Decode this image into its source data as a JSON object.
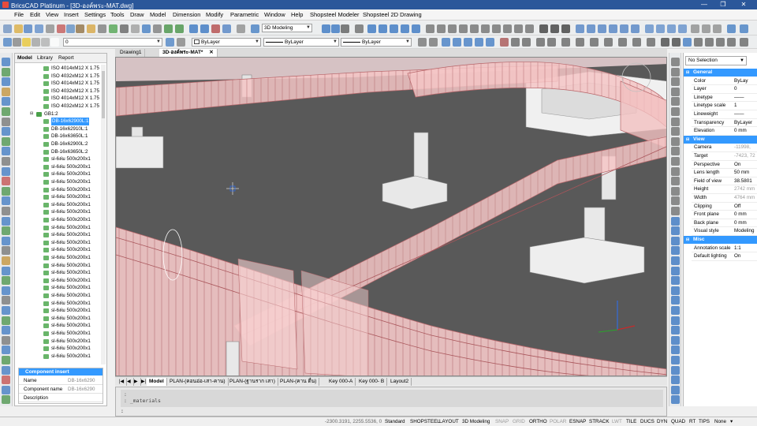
{
  "window": {
    "title": "BricsCAD Platinum - [3D-องค์พระ-MAT.dwg]",
    "controls": [
      "—",
      "❐",
      "✕"
    ]
  },
  "menu": [
    "File",
    "Edit",
    "View",
    "Insert",
    "Settings",
    "Tools",
    "Draw",
    "Model",
    "Dimension",
    "Modify",
    "Parametric",
    "Window",
    "Help",
    "Shopsteel Modeler",
    "Shopsteel 2D Drawing"
  ],
  "toolbar": {
    "layer_value": "0",
    "workspace": "3D Modeling",
    "color": "ByLayer",
    "linetype": "ByLayer",
    "lineweight": "ByLayer"
  },
  "explorer": {
    "tabs": [
      "Model",
      "Library",
      "Report"
    ],
    "tree": [
      {
        "label": "ISO 4014xM12 X 1.75",
        "indent": 4
      },
      {
        "label": "ISO 4032xM12 X 1.75",
        "indent": 4
      },
      {
        "label": "ISO 4014xM12 X 1.75",
        "indent": 4
      },
      {
        "label": "ISO 4032xM12 X 1.75",
        "indent": 4
      },
      {
        "label": "ISO 4014xM12 X 1.75",
        "indent": 4
      },
      {
        "label": "ISO 4032xM12 X 1.75",
        "indent": 4
      },
      {
        "label": "GB1:2",
        "indent": 3
      },
      {
        "label": "DB-16x62900L:1",
        "indent": 4,
        "selected": true
      },
      {
        "label": "DB-16x62910L:1",
        "indent": 4
      },
      {
        "label": "DB-16x63650L:1",
        "indent": 4
      },
      {
        "label": "DB-16x62900L:2",
        "indent": 4
      },
      {
        "label": "DB-16x63650L:2",
        "indent": 4
      },
      {
        "label": "sl-6ล่ม 500x200x1",
        "indent": 4
      },
      {
        "label": "sl-6ล่ม 500x200x1",
        "indent": 4
      },
      {
        "label": "sl-6ล่ม 500x200x1",
        "indent": 4
      },
      {
        "label": "sl-6ล่ม 500x200x1",
        "indent": 4
      },
      {
        "label": "sl-6ล่ม 500x200x1",
        "indent": 4
      },
      {
        "label": "sl-6ล่ม 500x200x1",
        "indent": 4
      },
      {
        "label": "sl-6ล่ม 500x200x1",
        "indent": 4
      },
      {
        "label": "sl-6ล่ม 500x200x1",
        "indent": 4
      },
      {
        "label": "sl-6ล่ม 500x200x1",
        "indent": 4
      },
      {
        "label": "sl-6ล่ม 500x200x1",
        "indent": 4
      },
      {
        "label": "sl-6ล่ม 500x200x1",
        "indent": 4
      },
      {
        "label": "sl-6ล่ม 500x200x1",
        "indent": 4
      },
      {
        "label": "sl-6ล่ม 500x200x1",
        "indent": 4
      },
      {
        "label": "sl-6ล่ม 500x200x1",
        "indent": 4
      },
      {
        "label": "sl-6ล่ม 500x200x1",
        "indent": 4
      },
      {
        "label": "sl-6ล่ม 500x200x1",
        "indent": 4
      },
      {
        "label": "sl-6ล่ม 500x200x1",
        "indent": 4
      },
      {
        "label": "sl-6ล่ม 500x200x1",
        "indent": 4
      },
      {
        "label": "sl-6ล่ม 500x200x1",
        "indent": 4
      },
      {
        "label": "sl-6ล่ม 500x200x1",
        "indent": 4
      },
      {
        "label": "sl-6ล่ม 500x200x1",
        "indent": 4
      },
      {
        "label": "sl-6ล่ม 500x200x1",
        "indent": 4
      },
      {
        "label": "sl-6ล่ม 500x200x1",
        "indent": 4
      },
      {
        "label": "sl-6ล่ม 500x200x1",
        "indent": 4
      },
      {
        "label": "sl-6ล่ม 500x200x1",
        "indent": 4
      },
      {
        "label": "sl-6ล่ม 500x200x1",
        "indent": 4
      },
      {
        "label": "sl-6ล่ม 500x200x1",
        "indent": 4
      }
    ],
    "component_insert": {
      "title": "Component insert",
      "rows": [
        {
          "key": "Name",
          "value": "DB-16x6290"
        },
        {
          "key": "Component name",
          "value": "DB-16x6290"
        },
        {
          "key": "Description",
          "value": ""
        }
      ]
    }
  },
  "doc_tabs": [
    "Drawing1",
    "3D-องค์พระ-MAT*"
  ],
  "layout_tabs": [
    "Model",
    "PLAN-(คอนอ่อ-เสา-คาน)",
    "PLAN-(ฐานราก เสา)",
    "PLAN-(คาน ตื่น)",
    "Key 000-A",
    "Key 000- B",
    "Layout2"
  ],
  "command": {
    "history": [
      ":",
      ": _materials"
    ],
    "prompt": ":"
  },
  "properties": {
    "selection": "No Selection",
    "categories": [
      {
        "name": "General",
        "rows": [
          {
            "key": "Color",
            "value": "ByLay"
          },
          {
            "key": "Layer",
            "value": "0"
          },
          {
            "key": "Linetype",
            "value": "——"
          },
          {
            "key": "Linetype scale",
            "value": "1"
          },
          {
            "key": "Lineweight",
            "value": "——"
          },
          {
            "key": "Transparency",
            "value": "ByLayer"
          },
          {
            "key": "Elevation",
            "value": "0 mm"
          }
        ]
      },
      {
        "name": "View",
        "rows": [
          {
            "key": "Camera",
            "value": "-11998,",
            "gray": true
          },
          {
            "key": "Target",
            "value": "-7423, 72",
            "gray": true
          },
          {
            "key": "Perspective",
            "value": "On"
          },
          {
            "key": "Lens length",
            "value": "50 mm"
          },
          {
            "key": "Field of view",
            "value": "38.5801"
          },
          {
            "key": "Height",
            "value": "2742 mm",
            "gray": true
          },
          {
            "key": "Width",
            "value": "4764 mm",
            "gray": true
          },
          {
            "key": "Clipping",
            "value": "Off"
          },
          {
            "key": "Front plane",
            "value": "0 mm"
          },
          {
            "key": "Back plane",
            "value": "0 mm"
          },
          {
            "key": "Visual style",
            "value": "Modeling"
          }
        ]
      },
      {
        "name": "Misc",
        "rows": [
          {
            "key": "Annotation scale",
            "value": "1:1"
          },
          {
            "key": "Default lighting",
            "value": "On"
          }
        ]
      }
    ]
  },
  "status": {
    "coords": "-2300.3191, 2255.5536, 0",
    "items": [
      {
        "label": "Standard",
        "on": true
      },
      {
        "label": "SHOPSTEEL",
        "on": true
      },
      {
        "label": "LAYOUT",
        "on": true
      },
      {
        "label": "3D Modeling",
        "on": true
      },
      {
        "label": "SNAP",
        "on": false
      },
      {
        "label": "GRID",
        "on": false
      },
      {
        "label": "ORTHO",
        "on": true
      },
      {
        "label": "POLAR",
        "on": false
      },
      {
        "label": "ESNAP",
        "on": true
      },
      {
        "label": "STRACK",
        "on": true
      },
      {
        "label": "LWT",
        "on": false
      },
      {
        "label": "TILE",
        "on": true
      },
      {
        "label": "DUCS",
        "on": true
      },
      {
        "label": "DYN",
        "on": true
      },
      {
        "label": "QUAD",
        "on": true
      },
      {
        "label": "RT",
        "on": true
      },
      {
        "label": "TIPS",
        "on": true
      },
      {
        "label": "None",
        "on": true
      }
    ]
  },
  "colors": {
    "accent": "#3399ff",
    "viewport_bg": "#595959",
    "beam_fill": "#f4c6c6",
    "beam_edge": "#b8666a",
    "column": "#e4e4e4"
  }
}
